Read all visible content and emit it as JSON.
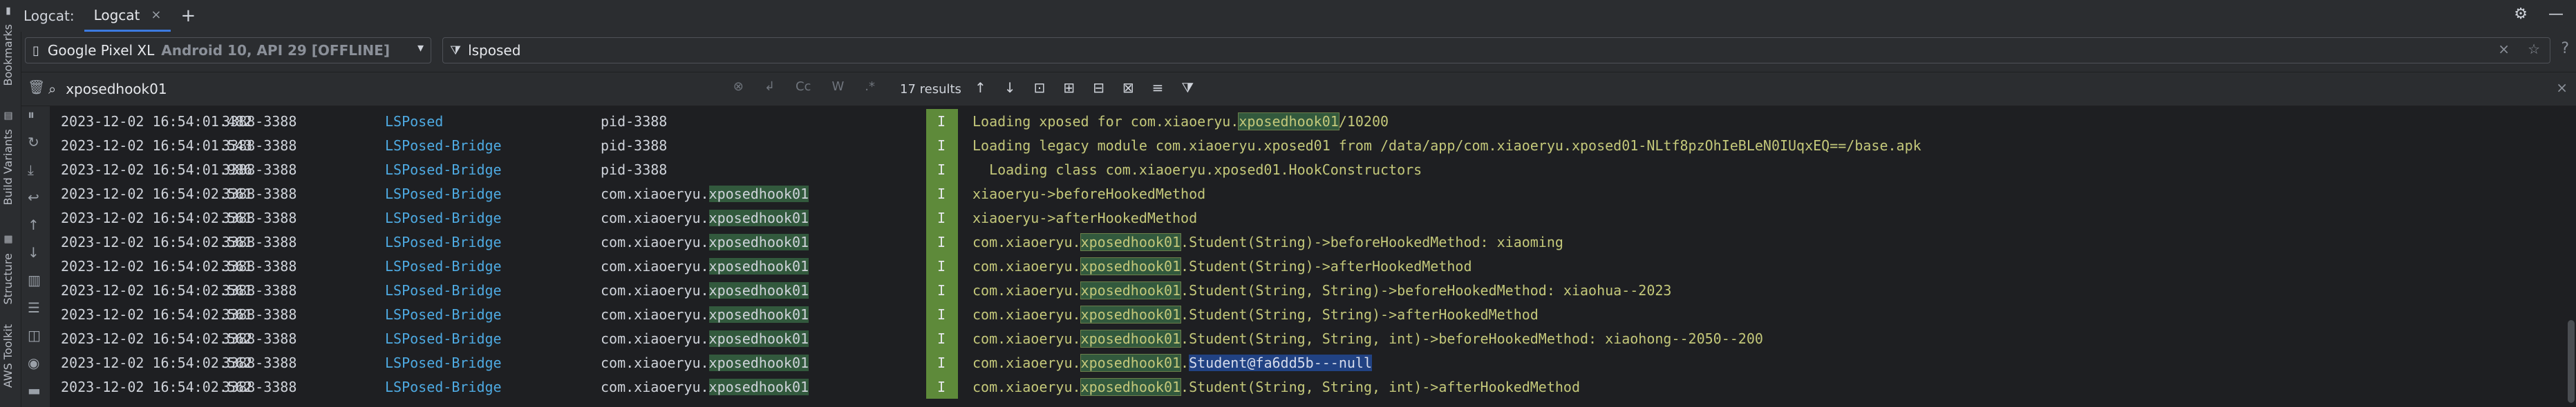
{
  "window": {
    "label": "Logcat:",
    "tab_label": "Logcat",
    "close_glyph": "×",
    "add_glyph": "+",
    "settings_glyph": "⚙",
    "minimize_glyph": "—"
  },
  "left_strip": {
    "items": [
      "Bookmarks",
      "Build Variants",
      "Structure",
      "AWS Toolkit"
    ]
  },
  "device_selector": {
    "name": "Google Pixel XL",
    "detail": "Android 10, API 29 [OFFLINE]"
  },
  "filter": {
    "value": "lsposed"
  },
  "search": {
    "value": "xposedhook01",
    "results": "17 results",
    "opt_case": "Cc",
    "opt_word": "W"
  },
  "log": {
    "rows": [
      {
        "ts": "2023-12-02 16:54:01.482",
        "pid": "3388-3388",
        "tag": "LSPosed",
        "pkg_pre": "pid-3388",
        "pkg_hl": "",
        "lvl": "I",
        "m_pre": "Loading xposed for com.xiaoeryu.",
        "m_hl": "xposedhook01",
        "m_post": "/10200",
        "m_sel": ""
      },
      {
        "ts": "2023-12-02 16:54:01.543",
        "pid": "3388-3388",
        "tag": "LSPosed-Bridge",
        "pkg_pre": "pid-3388",
        "pkg_hl": "",
        "lvl": "I",
        "m_pre": "Loading legacy module com.xiaoeryu.xposed01 from /data/app/com.xiaoeryu.xposed01-NLtf8pzOhIeBLeN0IUqxEQ==/base.apk",
        "m_hl": "",
        "m_post": "",
        "m_sel": ""
      },
      {
        "ts": "2023-12-02 16:54:01.986",
        "pid": "3388-3388",
        "tag": "LSPosed-Bridge",
        "pkg_pre": "pid-3388",
        "pkg_hl": "",
        "lvl": "I",
        "m_pre": "  Loading class com.xiaoeryu.xposed01.HookConstructors",
        "m_hl": "",
        "m_post": "",
        "m_sel": ""
      },
      {
        "ts": "2023-12-02 16:54:02.561",
        "pid": "3388-3388",
        "tag": "LSPosed-Bridge",
        "pkg_pre": "com.xiaoeryu.",
        "pkg_hl": "xposedhook01",
        "lvl": "I",
        "m_pre": "xiaoeryu->beforeHookedMethod",
        "m_hl": "",
        "m_post": "",
        "m_sel": ""
      },
      {
        "ts": "2023-12-02 16:54:02.561",
        "pid": "3388-3388",
        "tag": "LSPosed-Bridge",
        "pkg_pre": "com.xiaoeryu.",
        "pkg_hl": "xposedhook01",
        "lvl": "I",
        "m_pre": "xiaoeryu->afterHookedMethod",
        "m_hl": "",
        "m_post": "",
        "m_sel": ""
      },
      {
        "ts": "2023-12-02 16:54:02.561",
        "pid": "3388-3388",
        "tag": "LSPosed-Bridge",
        "pkg_pre": "com.xiaoeryu.",
        "pkg_hl": "xposedhook01",
        "lvl": "I",
        "m_pre": "com.xiaoeryu.",
        "m_hl": "xposedhook01",
        "m_post": ".Student(String)->beforeHookedMethod: xiaoming",
        "m_sel": ""
      },
      {
        "ts": "2023-12-02 16:54:02.561",
        "pid": "3388-3388",
        "tag": "LSPosed-Bridge",
        "pkg_pre": "com.xiaoeryu.",
        "pkg_hl": "xposedhook01",
        "lvl": "I",
        "m_pre": "com.xiaoeryu.",
        "m_hl": "xposedhook01",
        "m_post": ".Student(String)->afterHookedMethod",
        "m_sel": ""
      },
      {
        "ts": "2023-12-02 16:54:02.561",
        "pid": "3388-3388",
        "tag": "LSPosed-Bridge",
        "pkg_pre": "com.xiaoeryu.",
        "pkg_hl": "xposedhook01",
        "lvl": "I",
        "m_pre": "com.xiaoeryu.",
        "m_hl": "xposedhook01",
        "m_post": ".Student(String, String)->beforeHookedMethod: xiaohua--2023",
        "m_sel": ""
      },
      {
        "ts": "2023-12-02 16:54:02.561",
        "pid": "3388-3388",
        "tag": "LSPosed-Bridge",
        "pkg_pre": "com.xiaoeryu.",
        "pkg_hl": "xposedhook01",
        "lvl": "I",
        "m_pre": "com.xiaoeryu.",
        "m_hl": "xposedhook01",
        "m_post": ".Student(String, String)->afterHookedMethod",
        "m_sel": ""
      },
      {
        "ts": "2023-12-02 16:54:02.562",
        "pid": "3388-3388",
        "tag": "LSPosed-Bridge",
        "pkg_pre": "com.xiaoeryu.",
        "pkg_hl": "xposedhook01",
        "lvl": "I",
        "m_pre": "com.xiaoeryu.",
        "m_hl": "xposedhook01",
        "m_post": ".Student(String, String, int)->beforeHookedMethod: xiaohong--2050--200",
        "m_sel": ""
      },
      {
        "ts": "2023-12-02 16:54:02.562",
        "pid": "3388-3388",
        "tag": "LSPosed-Bridge",
        "pkg_pre": "com.xiaoeryu.",
        "pkg_hl": "xposedhook01",
        "lvl": "I",
        "m_pre": "com.xiaoeryu.",
        "m_hl": "xposedhook01",
        "m_post": ".",
        "m_sel": "Student@fa6dd5b---null"
      },
      {
        "ts": "2023-12-02 16:54:02.562",
        "pid": "3388-3388",
        "tag": "LSPosed-Bridge",
        "pkg_pre": "com.xiaoeryu.",
        "pkg_hl": "xposedhook01",
        "lvl": "I",
        "m_pre": "com.xiaoeryu.",
        "m_hl": "xposedhook01",
        "m_post": ".Student(String, String, int)->afterHookedMethod",
        "m_sel": ""
      }
    ]
  },
  "colors": {
    "background": "#2b2d30",
    "log_background": "#1e1f22",
    "tag": "#4eaae2",
    "message": "#c4c87a",
    "level_info": "#5e8a3a",
    "match_highlight": "#32593d",
    "selection": "#214283"
  }
}
